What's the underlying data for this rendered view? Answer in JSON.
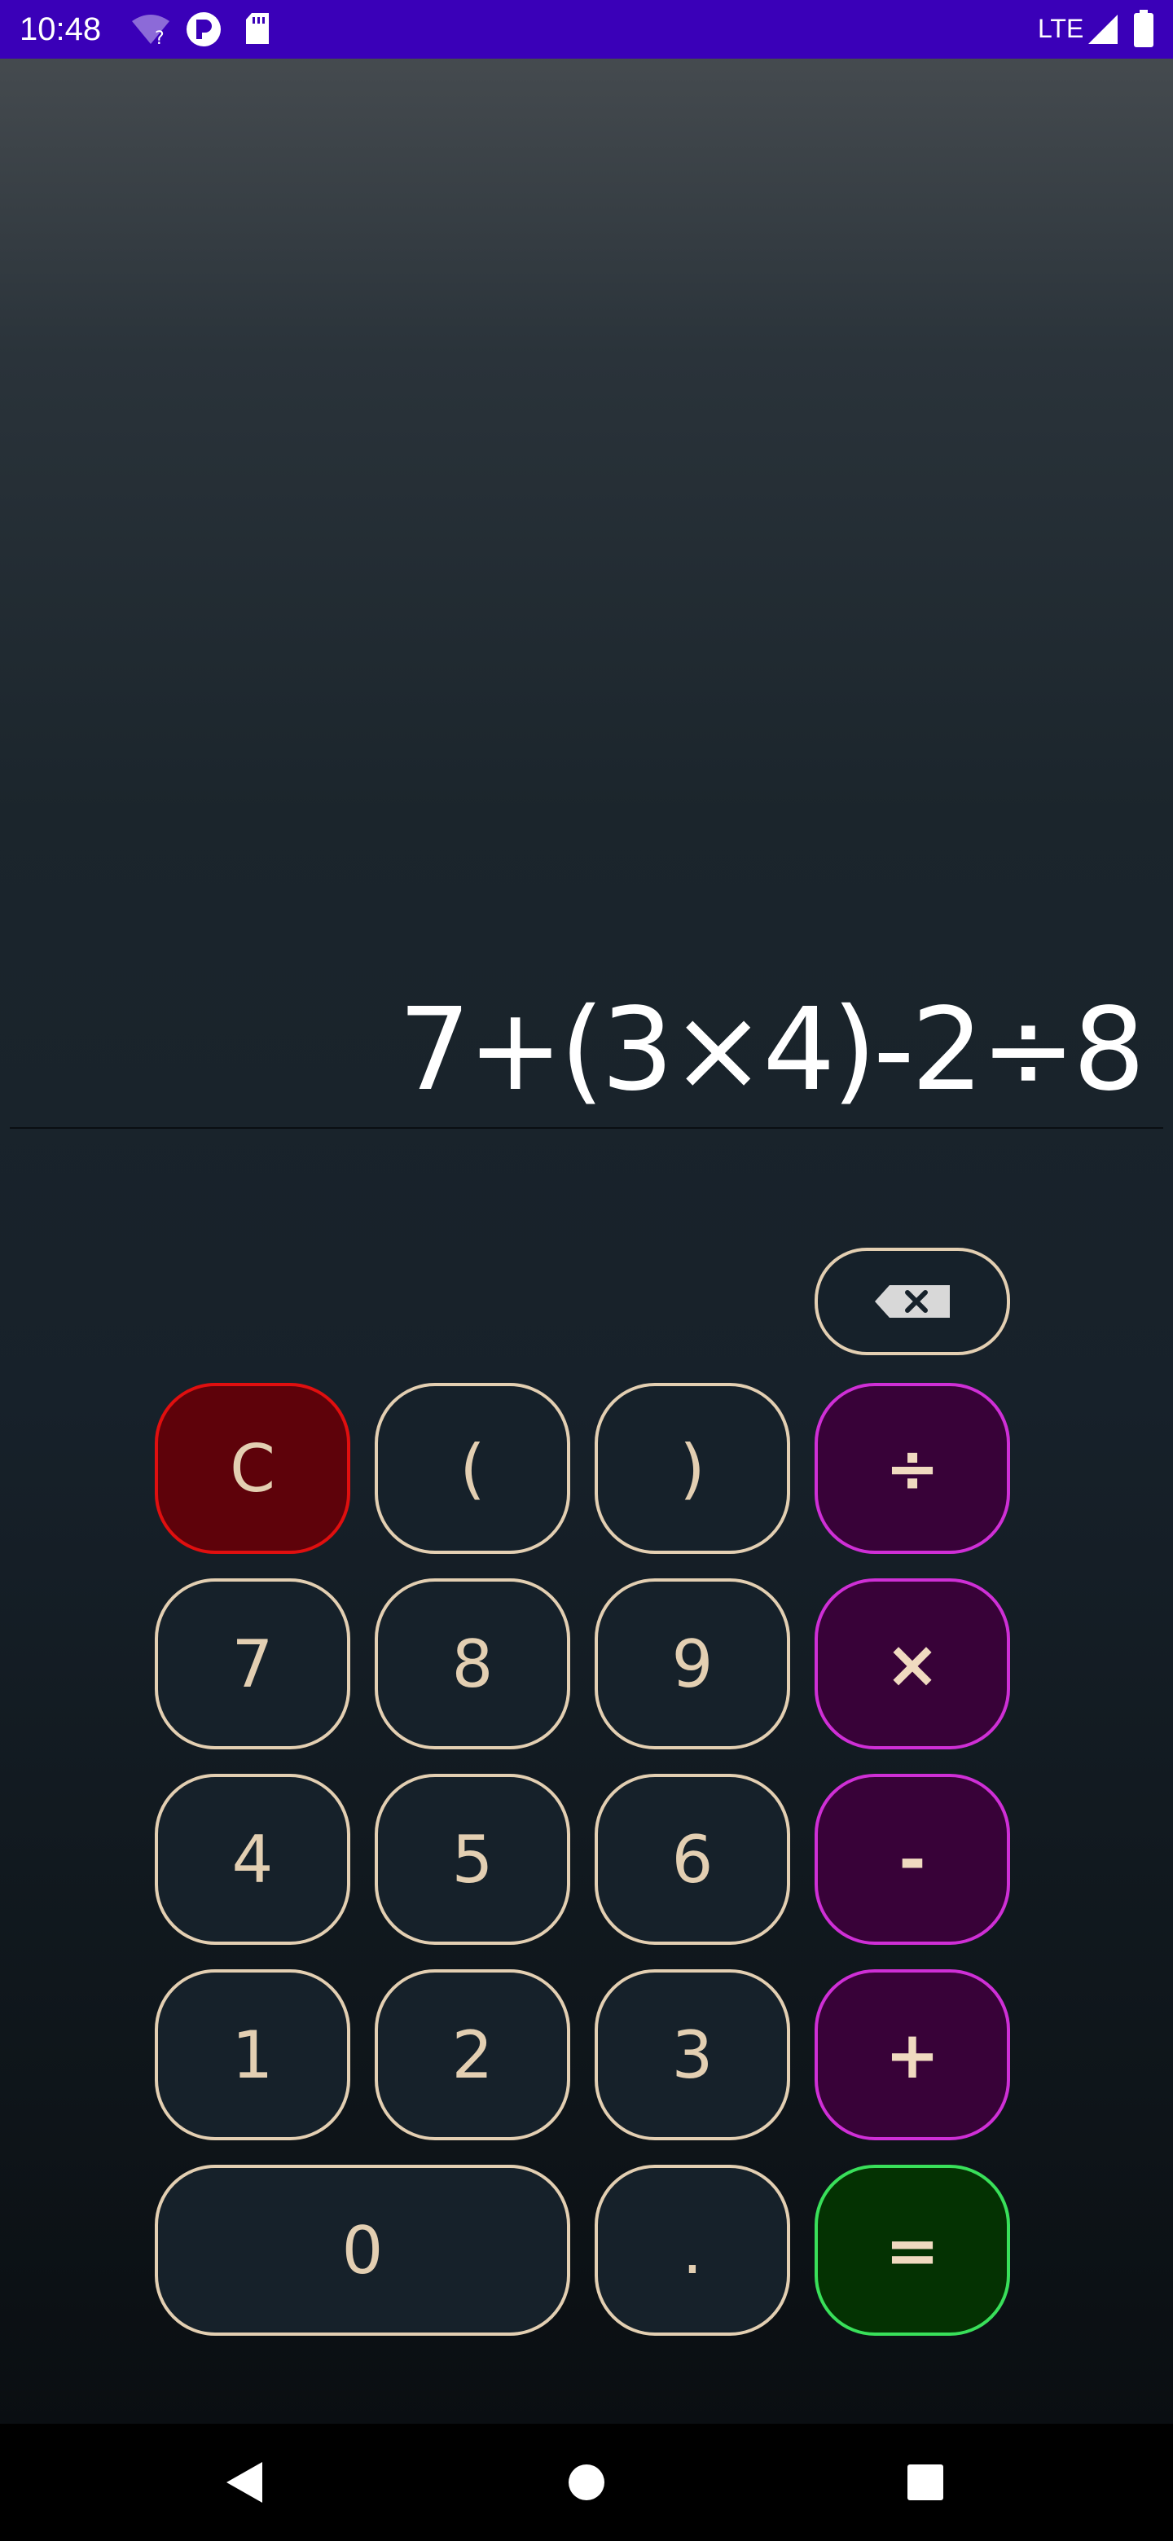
{
  "status_bar": {
    "time": "10:48",
    "network": "LTE",
    "icons": [
      "wifi-unknown-icon",
      "app-notification-icon",
      "sd-card-icon",
      "signal-icon",
      "battery-icon"
    ]
  },
  "display": {
    "expression": "7+(3×4)-2÷8"
  },
  "keys": {
    "backspace": "backspace-icon",
    "clear": "C",
    "open_paren": "(",
    "close_paren": ")",
    "divide": "÷",
    "seven": "7",
    "eight": "8",
    "nine": "9",
    "multiply": "×",
    "four": "4",
    "five": "5",
    "six": "6",
    "subtract": "-",
    "one": "1",
    "two": "2",
    "three": "3",
    "add": "+",
    "zero": "0",
    "decimal": ".",
    "equals": "="
  },
  "colors": {
    "status_bar": "#3a00b8",
    "key_border": "#e3cfb2",
    "operator_border": "#cf2fd6",
    "clear_border": "#e00f0f",
    "equals_border": "#39e05a"
  },
  "nav_bar": {
    "icons": [
      "back-icon",
      "home-icon",
      "recents-icon"
    ]
  }
}
